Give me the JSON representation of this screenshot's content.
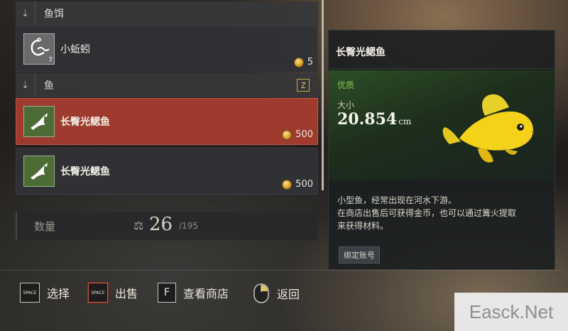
{
  "categories": {
    "bait": {
      "label": "鱼饵",
      "arrow": "⇣"
    },
    "fish": {
      "label": "鱼",
      "arrow": "⇣",
      "hotkey": "Z"
    }
  },
  "items": [
    {
      "name": "小蚯蚓",
      "price": "5",
      "qty": "7",
      "icon": "worm-hook-icon",
      "selected": false
    },
    {
      "name": "长臀光鳃鱼",
      "price": "500",
      "icon": "fish-icon",
      "selected": true
    },
    {
      "name": "长臀光鳃鱼",
      "price": "500",
      "icon": "fish-icon",
      "selected": false
    }
  ],
  "count": {
    "label": "数量",
    "value": "26",
    "max": "/195",
    "icon": "weight-icon"
  },
  "detail": {
    "title": "长臀光鳃鱼",
    "grade": "优质",
    "size_label": "大小",
    "size_value": "20.854",
    "size_unit": "cm",
    "description_lines": [
      "小型鱼，经常出现在河水下游。",
      "在商店出售后可获得金币，也可以通过篝火提取",
      "来获得材料。"
    ],
    "bind_tag": "绑定账号"
  },
  "actions": [
    {
      "key": "SPACE",
      "label": "选择"
    },
    {
      "key": "SPACE",
      "label": "出售"
    },
    {
      "key": "F",
      "label": "查看商店"
    },
    {
      "key": "mouse-icon",
      "label": "返回"
    }
  ],
  "watermark": "Easck.Net",
  "colors": {
    "selected": "#9e3a2e",
    "grade": "#8bc45e",
    "coin": "#c8901e",
    "fish_icon_bg": "#4d6b35"
  }
}
